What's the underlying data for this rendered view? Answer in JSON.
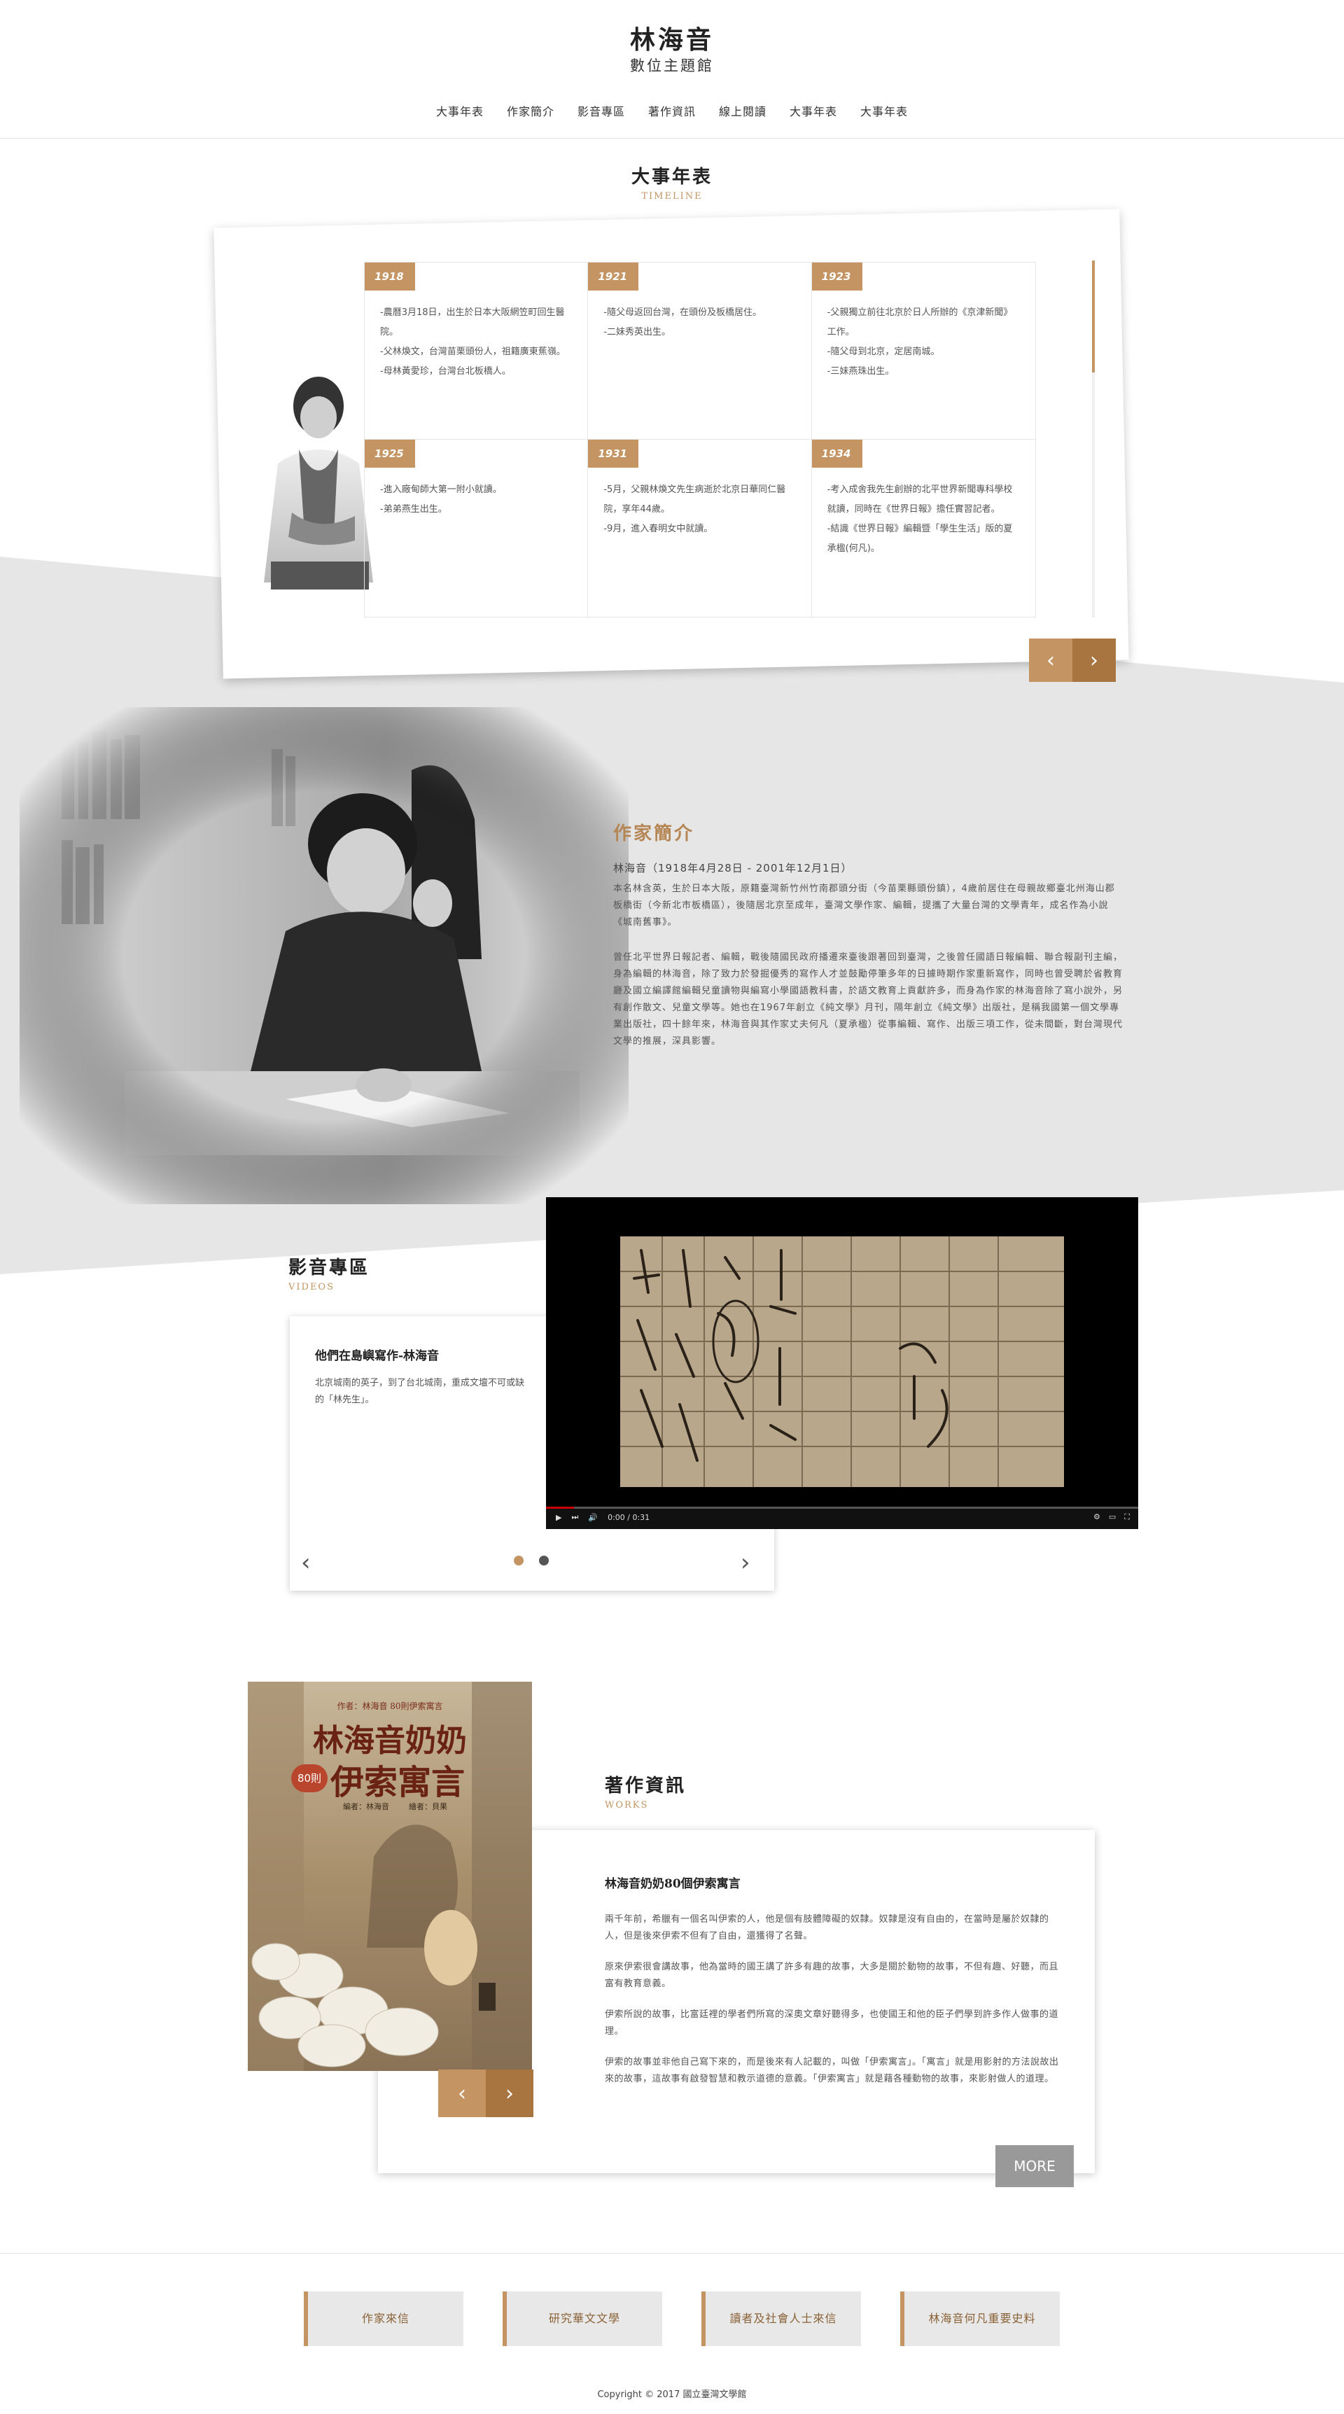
{
  "header": {
    "title": "林海音",
    "subtitle": "數位主題館",
    "nav": [
      "大事年表",
      "作家簡介",
      "影音專區",
      "著作資訊",
      "線上閱讀",
      "大事年表",
      "大事年表"
    ]
  },
  "timeline": {
    "title": "大事年表",
    "title_en": "TIMELINE",
    "entries": [
      {
        "year": "1918",
        "text": "-農曆3月18日，出生於日本大阪網笠町回生醫院。\n-父林煥文，台灣苗栗頭份人，祖籍廣東蕉嶺。\n-母林黃愛珍，台灣台北板橋人。"
      },
      {
        "year": "1921",
        "text": "-隨父母返回台灣，在頭份及板橋居住。\n-二妹秀英出生。"
      },
      {
        "year": "1923",
        "text": "-父親獨立前往北京於日人所辦的《京津新聞》工作。\n-隨父母到北京，定居南城。\n-三妹燕珠出生。"
      },
      {
        "year": "1925",
        "text": "-進入廠甸師大第一附小就讀。\n-弟弟燕生出生。"
      },
      {
        "year": "1931",
        "text": "-5月，父親林煥文先生病逝於北京日華同仁醫院，享年44歲。\n-9月，進入春明女中就讀。"
      },
      {
        "year": "1934",
        "text": "-考入成舍我先生創辦的北平世界新聞專科學校就讀，同時在《世界日報》擔任實習記者。\n-結識《世界日報》編輯暨「學生生活」版的夏承楹(何凡)。"
      }
    ],
    "prev_icon": "chevron-left-icon",
    "next_icon": "chevron-right-icon"
  },
  "author": {
    "title": "作家簡介",
    "life": "林海音（1918年4月28日 - 2001年12月1日）",
    "para1": "本名林含英，生於日本大阪，原籍臺灣新竹州竹南郡頭分街（今苗栗縣頭份鎮），4歲前居住在母親故鄉臺北州海山郡板橋街（今新北市板橋區），後隨居北京至成年，臺灣文學作家、編輯，提攜了大量台灣的文學青年，成名作為小說《城南舊事》。",
    "para2": "曾任北平世界日報記者、編輯，戰後隨國民政府播遷來臺後跟著回到臺灣，之後曾任國語日報編輯、聯合報副刊主編，身為編輯的林海音，除了致力於發掘優秀的寫作人才並鼓勵停筆多年的日據時期作家重新寫作，同時也曾受聘於省教育廳及國立編譯館編輯兒童讀物與編寫小學國語教科書，於語文教育上貢獻許多，而身為作家的林海音除了寫小說外，另有創作散文、兒童文學等。她也在1967年創立《純文學》月刊，隔年創立《純文學》出版社，是稱我國第一個文學專業出版社，四十餘年來，林海音與其作家丈夫何凡（夏承楹）從事編輯、寫作、出版三項工作，從未間斷，對台灣現代文學的推展，深具影響。"
  },
  "video": {
    "title": "影音專區",
    "title_en": "VIDEOS",
    "item_title": "他們在島嶼寫作-林海音",
    "item_desc": "北京城南的英子，到了台北城南，重成文壇不可或缺的「林先生」。",
    "time": "0:00 / 0:31",
    "slide_index": 1,
    "slide_count": 2,
    "play_icon": "play-icon",
    "volume_icon": "volume-icon",
    "settings_icon": "gear-icon",
    "fullscreen_icon": "fullscreen-icon"
  },
  "works": {
    "title": "著作資訊",
    "title_en": "WORKS",
    "book_top": "作者：林海音 80則伊索寓言",
    "book_title_1": "林海音奶奶",
    "book_badge": "80則",
    "book_title_2": "伊索寓言",
    "book_author": "編者：林海音",
    "book_illustrator": "繪者：貝果",
    "item_title": "林海音奶奶80個伊索寓言",
    "paragraphs": [
      "兩千年前，希臘有一個名叫伊索的人，他是個有肢體障礙的奴隸。奴隸是沒有自由的，在當時是屬於奴隸的人，但是後來伊索不但有了自由，還獲得了名聲。",
      "原來伊索很會講故事，他為當時的國王講了許多有趣的故事，大多是關於動物的故事，不但有趣、好聽，而且富有教育意義。",
      "伊索所說的故事，比富廷裡的學者們所寫的深奧文章好聽得多，也使國王和他的臣子們學到許多作人做事的道理。",
      "伊索的故事並非他自己寫下來的，而是後來有人記載的，叫做「伊索寓言」。「寓言」就是用影射的方法說故出來的故事，這故事有啟發智慧和教示道德的意義。「伊索寓言」就是藉各種動物的故事，來影射做人的道理。"
    ],
    "more": "MORE"
  },
  "footer": {
    "links": [
      "作家來信",
      "研究華文文學",
      "讀者及社會人士來信",
      "林海音何凡重要史料"
    ],
    "copyright": "Copyright © 2017 國立臺灣文學館"
  },
  "colors": {
    "accent": "#c49462",
    "accent_dark": "#a8743f",
    "band": "#e6e6e6"
  }
}
